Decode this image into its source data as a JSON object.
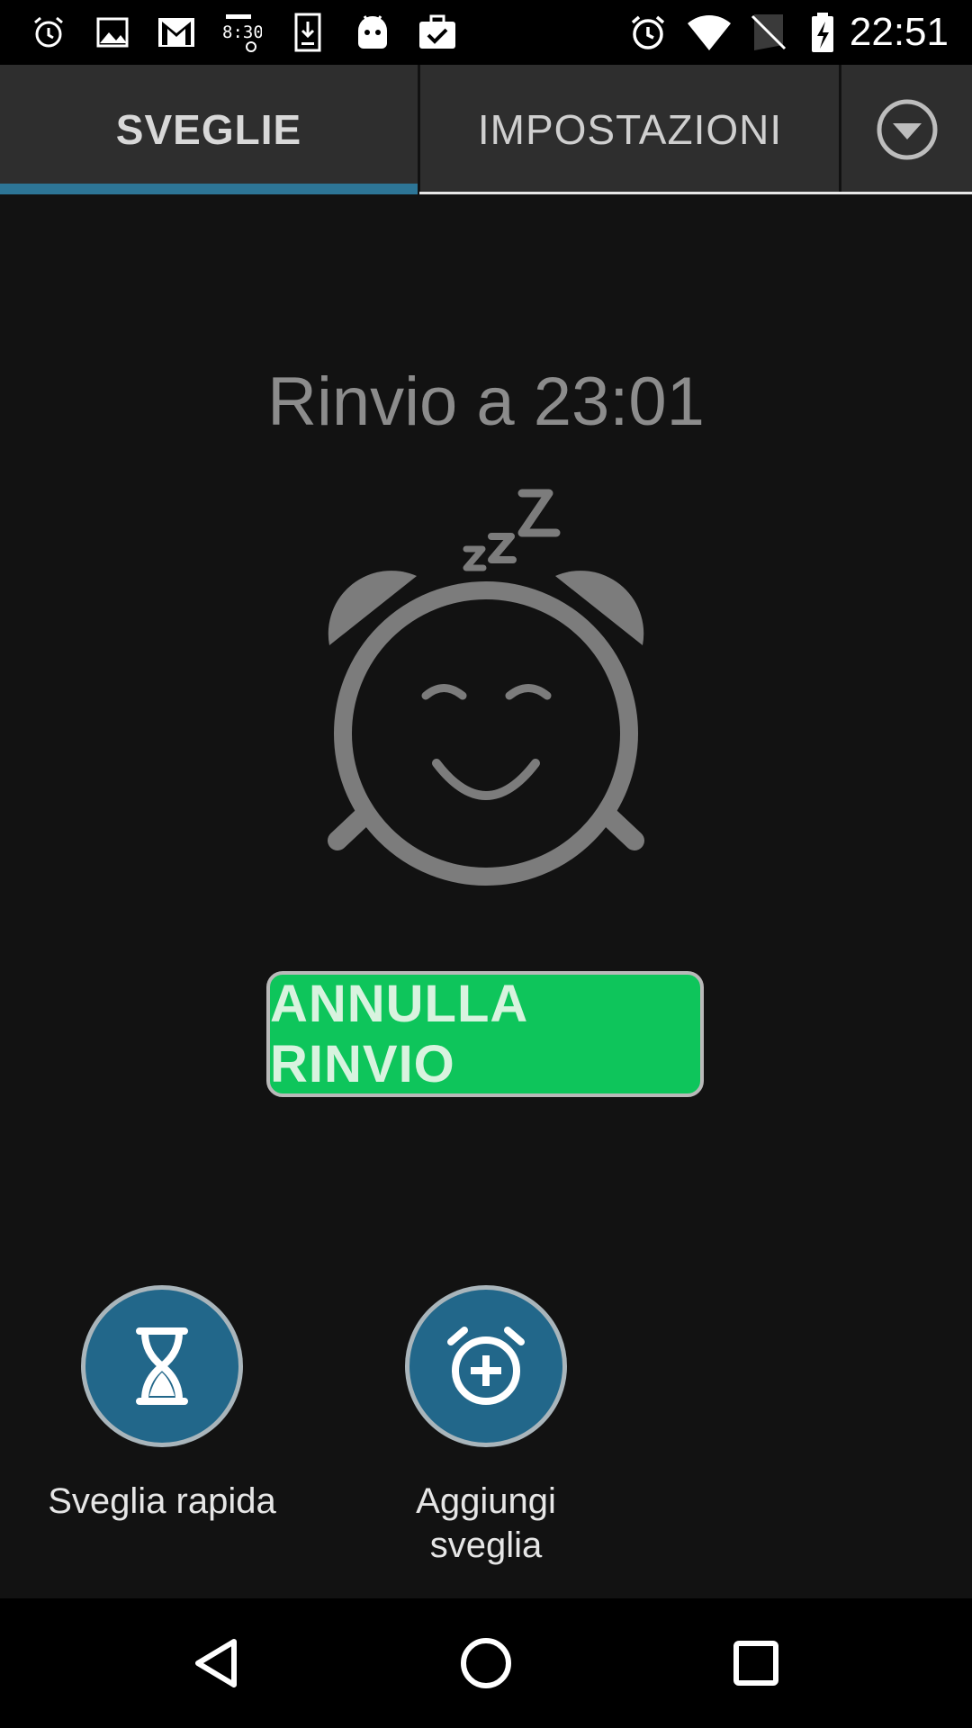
{
  "status_bar": {
    "time": "22:51",
    "left_icons": [
      "alarm-icon",
      "image-icon",
      "gmail-icon",
      "widget-clock-icon",
      "download-icon",
      "android-icon",
      "clipboard-check-icon"
    ],
    "right_icons": [
      "alarm-icon",
      "wifi-icon",
      "no-sim-icon",
      "battery-charging-icon"
    ]
  },
  "tabs": [
    {
      "label": "SVEGLIE",
      "selected": true
    },
    {
      "label": "IMPOSTAZIONI",
      "selected": false
    }
  ],
  "overflow_icon": "dropdown-circle-icon",
  "snooze": {
    "title": "Rinvio a 23:01",
    "illustration": "sleeping-alarm-clock-icon",
    "cancel_button_label": "ANNULLA RINVIO"
  },
  "actions": {
    "quick_alarm": {
      "label": "Sveglia rapida",
      "icon": "hourglass-icon"
    },
    "add_alarm": {
      "label": "Aggiungi sveglia",
      "icon": "alarm-add-icon"
    }
  },
  "nav_bar": {
    "icons": [
      "back-icon",
      "home-icon",
      "recents-icon"
    ]
  },
  "colors": {
    "background": "#121212",
    "tab_indicator": "#2d7596",
    "cancel_button": "#0ec55b",
    "fab": "#22678a"
  }
}
